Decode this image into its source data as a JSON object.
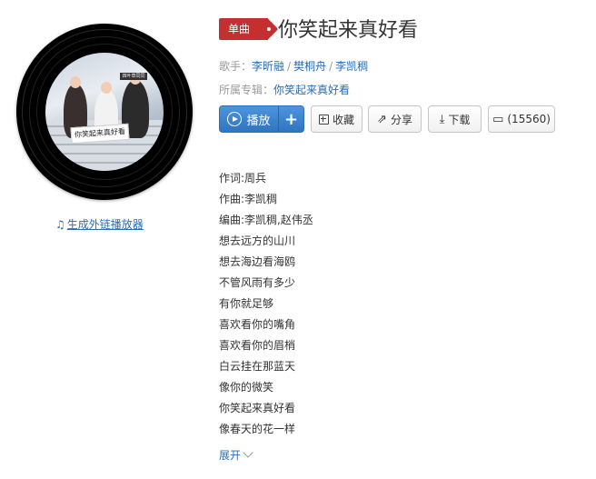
{
  "album_art": {
    "sign_text": "你笑起来真好看",
    "tag_text": "四叶草同同"
  },
  "external_player_link": "生成外链播放器",
  "song": {
    "type_badge": "单曲",
    "title": "你笑起来真好看",
    "singer_label": "歌手：",
    "singers": [
      "李昕融",
      "樊桐舟",
      "李凯稠"
    ],
    "album_label": "所属专辑：",
    "album": "你笑起来真好看"
  },
  "actions": {
    "play": "播放",
    "add": "+",
    "collect": "收藏",
    "share": "分享",
    "download": "下载",
    "comments": "(15560)"
  },
  "lyrics": [
    "作词:周兵",
    "作曲:李凯稠",
    "编曲:李凯稠,赵伟丞",
    "想去远方的山川",
    "想去海边看海鸥",
    "不管风雨有多少",
    "有你就足够",
    "喜欢看你的嘴角",
    "喜欢看你的眉梢",
    "白云挂在那蓝天",
    "像你的微笑",
    "你笑起来真好看",
    "像春天的花一样"
  ],
  "expand_label": "展开",
  "colors": {
    "badge_red": "#c62f2f",
    "link_blue": "#2a6db5",
    "play_blue": "#3a82cc"
  }
}
